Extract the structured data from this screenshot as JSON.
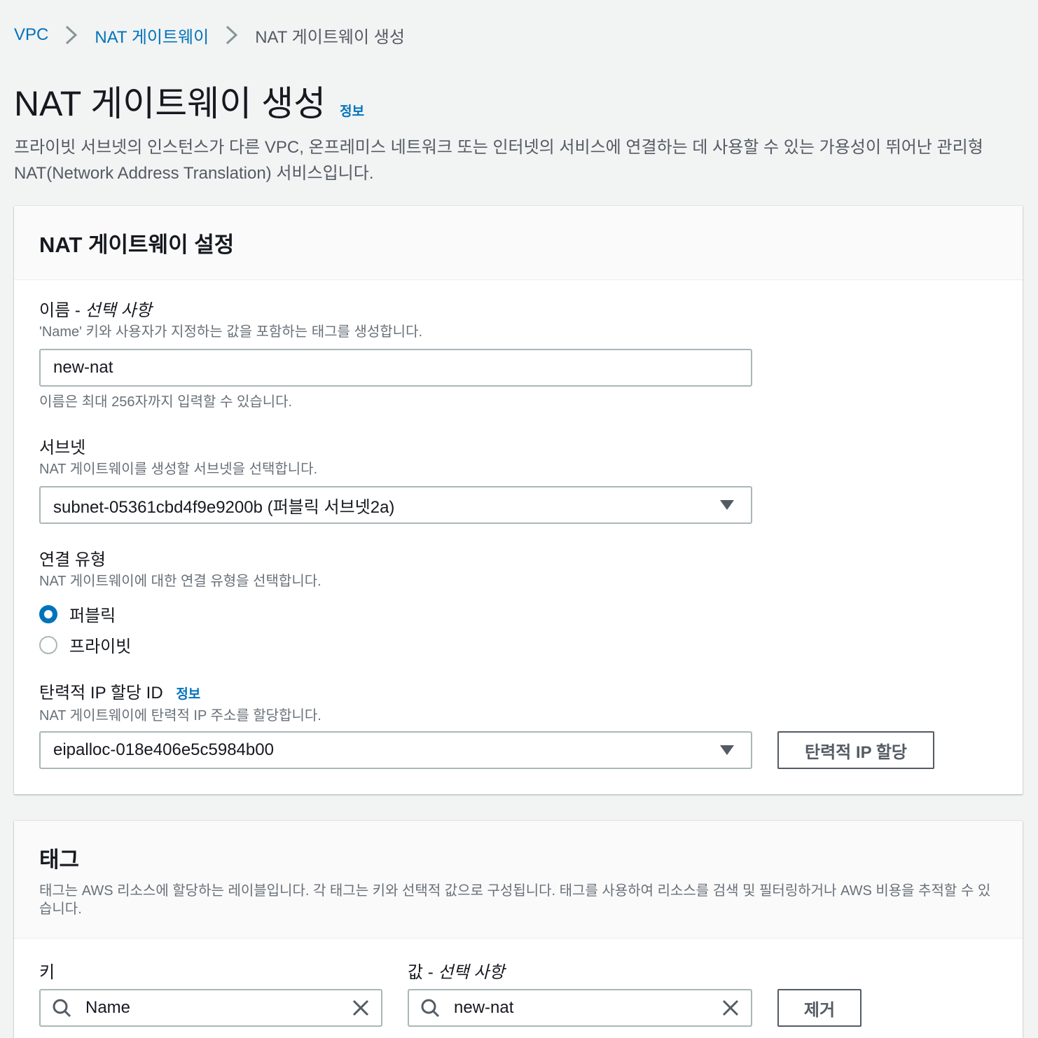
{
  "breadcrumb": {
    "items": [
      "VPC",
      "NAT 게이트웨이"
    ],
    "current": "NAT 게이트웨이 생성"
  },
  "page": {
    "title": "NAT 게이트웨이 생성",
    "info_link": "정보",
    "description": "프라이빗 서브넷의 인스턴스가 다른 VPC, 온프레미스 네트워크 또는 인터넷의 서비스에 연결하는 데 사용할 수 있는 가용성이 뛰어난 관리형 NAT(Network Address Translation) 서비스입니다."
  },
  "settings": {
    "title": "NAT 게이트웨이 설정",
    "name": {
      "label": "이름 - ",
      "label_optional": "선택 사항",
      "description": "'Name' 키와 사용자가 지정하는 값을 포함하는 태그를 생성합니다.",
      "value": "new-nat",
      "constraint": "이름은 최대 256자까지 입력할 수 있습니다."
    },
    "subnet": {
      "label": "서브넷",
      "description": "NAT 게이트웨이를 생성할 서브넷을 선택합니다.",
      "value": "subnet-05361cbd4f9e9200b (퍼블릭 서브넷2a)"
    },
    "connectivity": {
      "label": "연결 유형",
      "description": "NAT 게이트웨이에 대한 연결 유형을 선택합니다.",
      "options": [
        "퍼블릭",
        "프라이빗"
      ],
      "selected": "퍼블릭"
    },
    "eip": {
      "label": "탄력적 IP 할당 ID",
      "info_link": "정보",
      "description": "NAT 게이트웨이에 탄력적 IP 주소를 할당합니다.",
      "value": "eipalloc-018e406e5c5984b00",
      "allocate_button": "탄력적 IP 할당"
    }
  },
  "tags": {
    "title": "태그",
    "description": "태그는 AWS 리소스에 할당하는 레이블입니다. 각 태그는 키와 선택적 값으로 구성됩니다. 태그를 사용하여 리소스를 검색 및 필터링하거나 AWS 비용을 추적할 수 있습니다.",
    "key_label": "키",
    "value_label": "값 - ",
    "value_label_optional": "선택 사항",
    "rows": [
      {
        "key": "Name",
        "value": "new-nat"
      }
    ],
    "remove_button": "제거"
  },
  "colors": {
    "link": "#0073bb",
    "background": "#f2f3f3",
    "border": "#aab7b8"
  },
  "icons": [
    "chevron-right-icon",
    "caret-down-icon",
    "search-icon",
    "close-icon"
  ]
}
